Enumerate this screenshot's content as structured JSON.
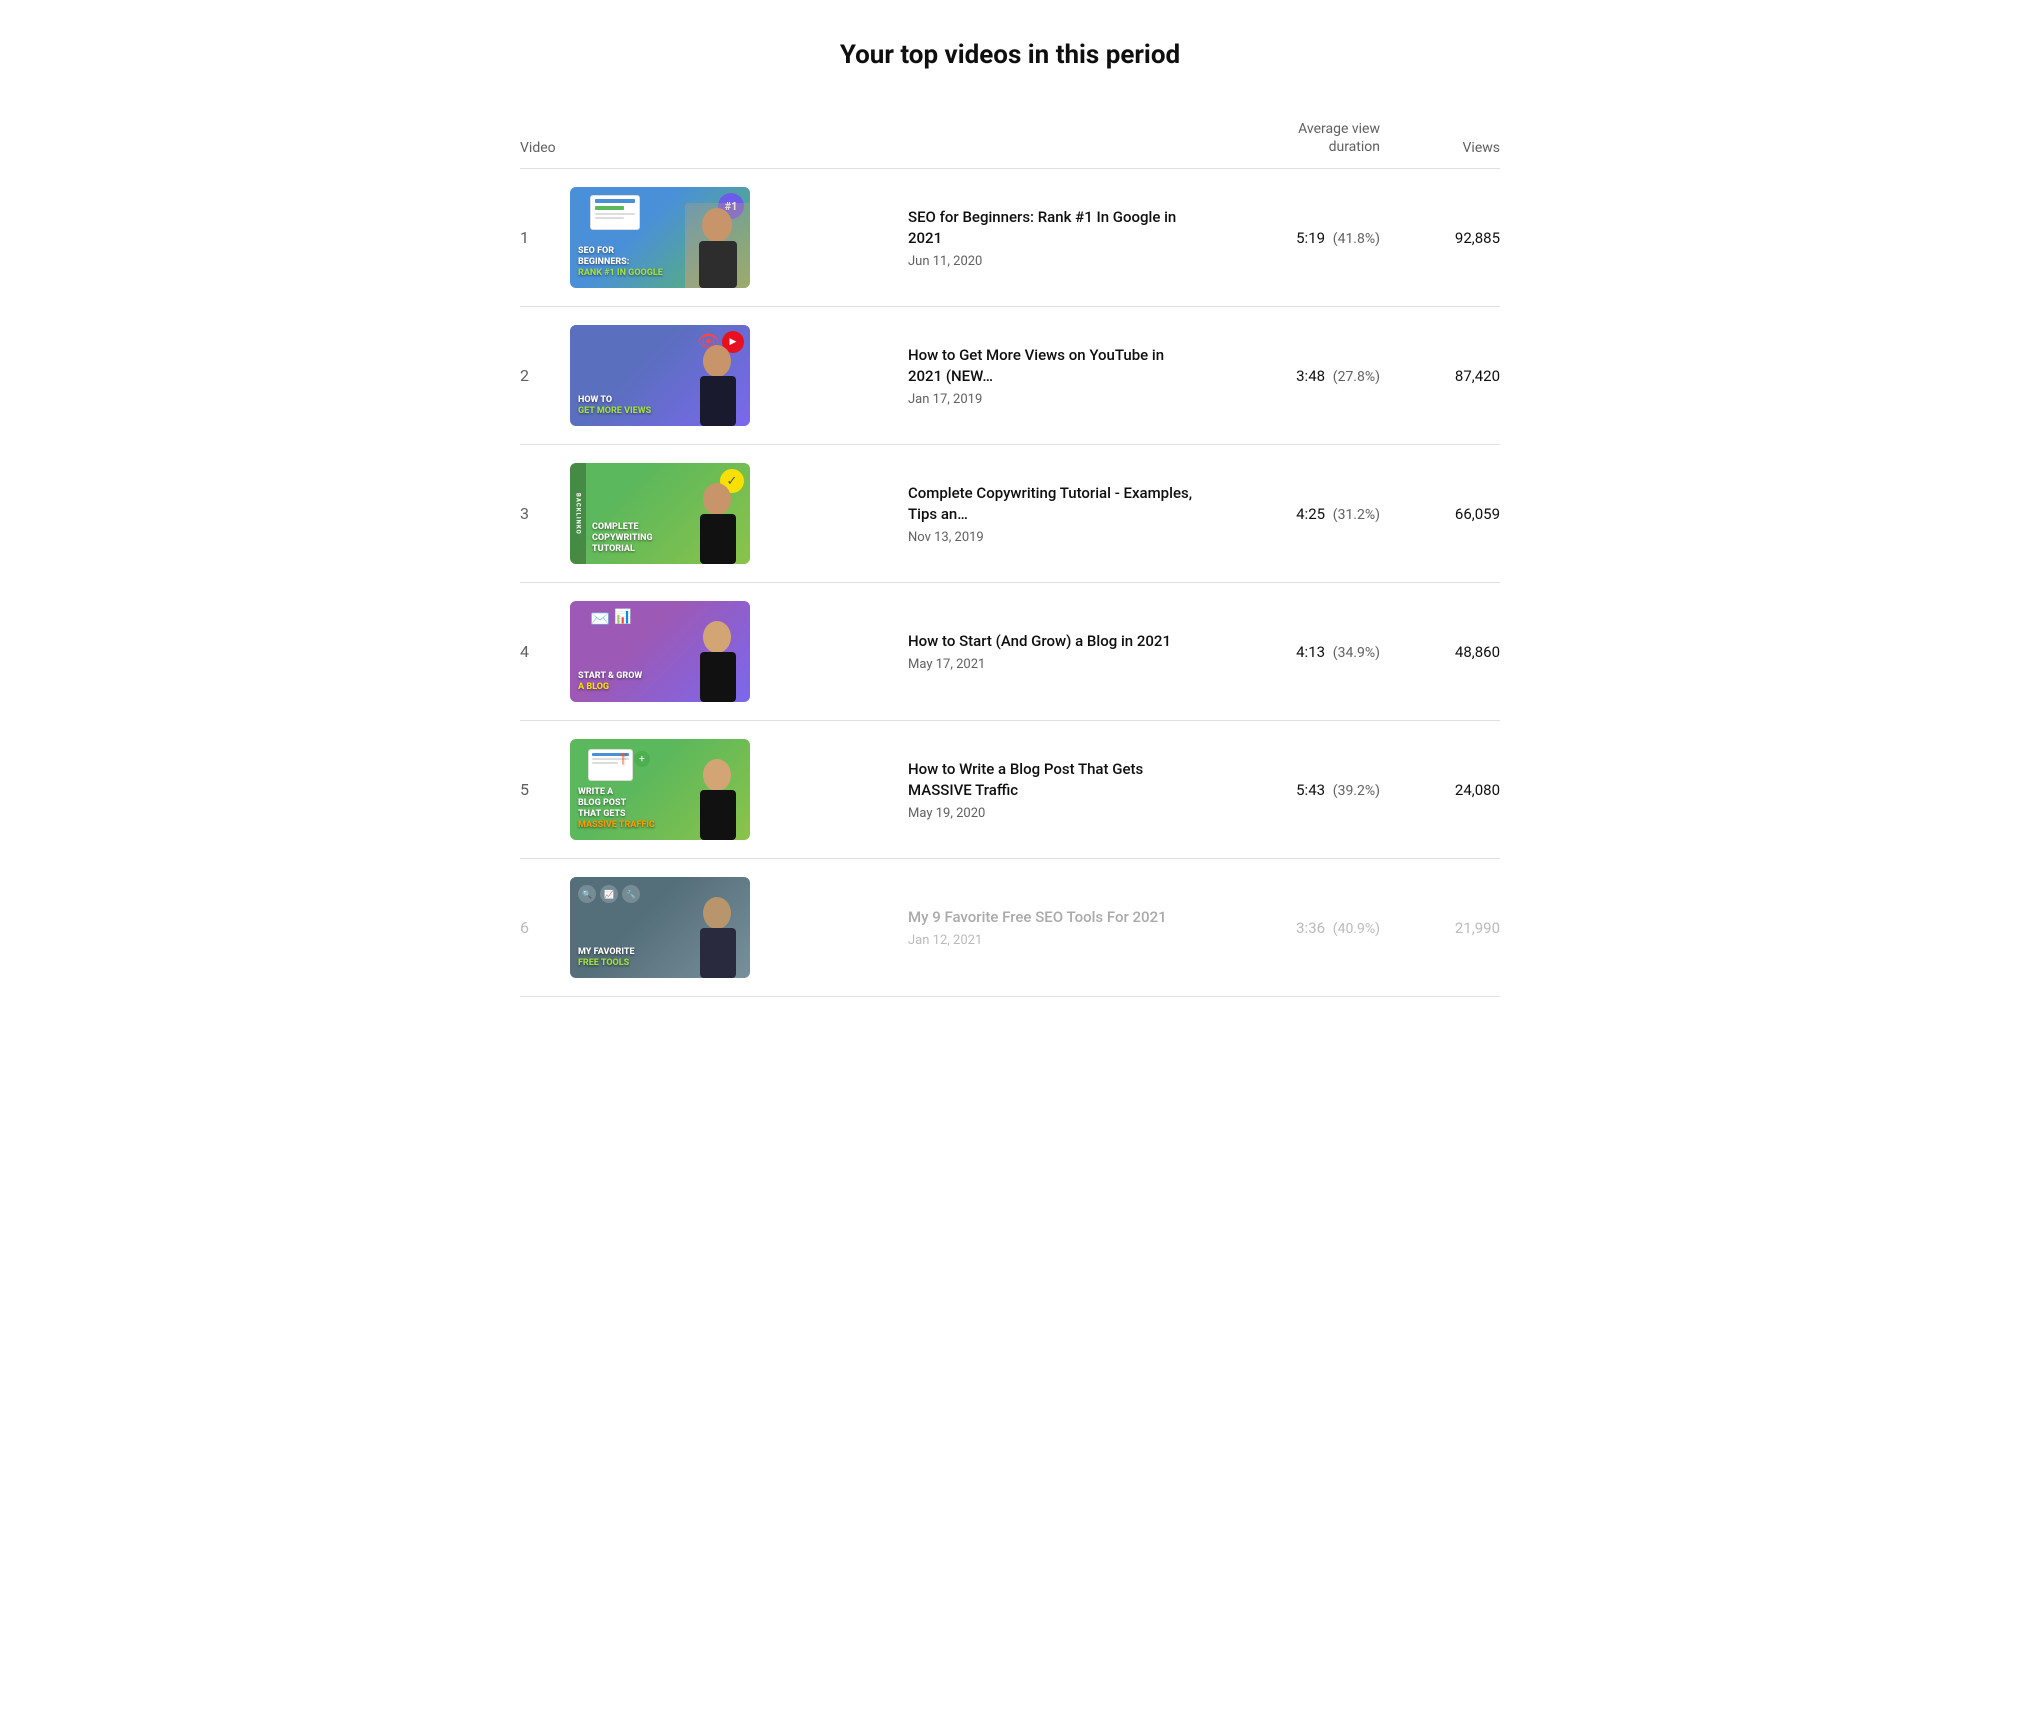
{
  "page": {
    "title": "Your top videos in this period"
  },
  "table": {
    "headers": {
      "video": "Video",
      "avg_duration": "Average view\nduration",
      "views": "Views"
    },
    "videos": [
      {
        "rank": "1",
        "title": "SEO for Beginners: Rank #1 In Google in 2021",
        "date": "Jun 11, 2020",
        "avg_time": "5:19",
        "avg_pct": "(41.8%)",
        "views": "92,885",
        "thumb_type": "1",
        "thumb_lines": [
          "SEO FOR",
          "BEGINNERS:",
          "RANK #1 IN GOOGLE"
        ],
        "badge": "#1",
        "dimmed": false
      },
      {
        "rank": "2",
        "title": "How to Get More Views on YouTube in 2021 (NEW…",
        "date": "Jan 17, 2019",
        "avg_time": "3:48",
        "avg_pct": "(27.8%)",
        "views": "87,420",
        "thumb_type": "2",
        "thumb_lines": [
          "HOW TO",
          "GET MORE VIEWS"
        ],
        "badge": null,
        "dimmed": false
      },
      {
        "rank": "3",
        "title": "Complete Copywriting Tutorial - Examples, Tips an…",
        "date": "Nov 13, 2019",
        "avg_time": "4:25",
        "avg_pct": "(31.2%)",
        "views": "66,059",
        "thumb_type": "3",
        "thumb_lines": [
          "COMPLETE",
          "COPYWRITING",
          "TUTORIAL"
        ],
        "badge": null,
        "dimmed": false
      },
      {
        "rank": "4",
        "title": "How to Start (And Grow) a Blog in 2021",
        "date": "May 17, 2021",
        "avg_time": "4:13",
        "avg_pct": "(34.9%)",
        "views": "48,860",
        "thumb_type": "4",
        "thumb_lines": [
          "START & GROW",
          "A BLOG"
        ],
        "badge": null,
        "dimmed": false
      },
      {
        "rank": "5",
        "title": "How to Write a Blog Post That Gets MASSIVE Traffic",
        "date": "May 19, 2020",
        "avg_time": "5:43",
        "avg_pct": "(39.2%)",
        "views": "24,080",
        "thumb_type": "5",
        "thumb_lines": [
          "WRITE A",
          "BLOG POST",
          "THAT GETS MASSIVE TRAFFIC"
        ],
        "badge": null,
        "dimmed": false
      },
      {
        "rank": "6",
        "title": "My 9 Favorite Free SEO Tools For 2021",
        "date": "Jan 12, 2021",
        "avg_time": "3:36",
        "avg_pct": "(40.9%)",
        "views": "21,990",
        "thumb_type": "6",
        "thumb_lines": [
          "MY FAVORITE",
          "FREE TOOLS"
        ],
        "badge": null,
        "dimmed": true
      }
    ]
  }
}
